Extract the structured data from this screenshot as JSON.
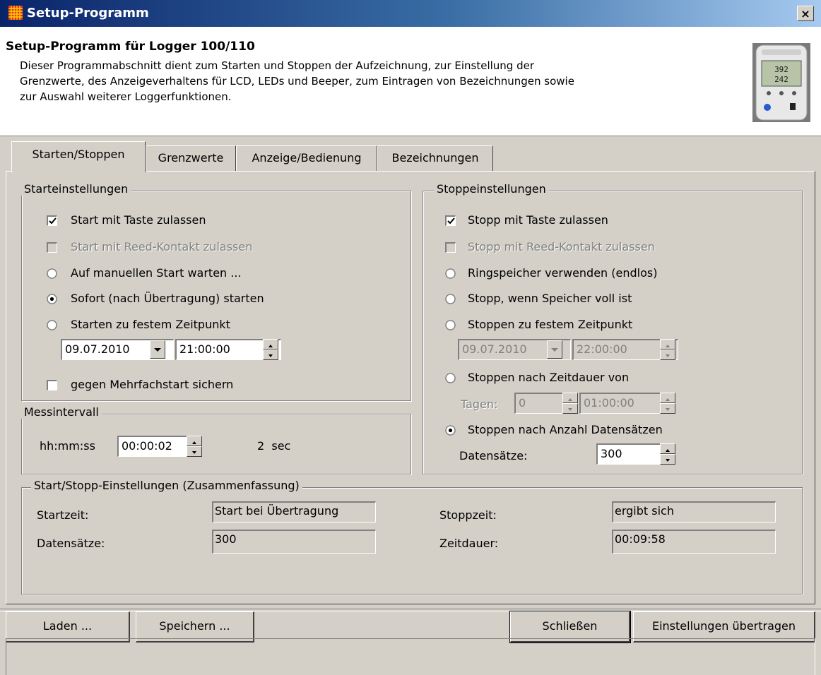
{
  "window": {
    "title": "Setup-Programm",
    "close_label": "×"
  },
  "header": {
    "title": "Setup-Programm für Logger 100/110",
    "desc_line1": "Dieser Programmabschnitt dient zum Starten und Stoppen der Aufzeichnung, zur Einstellung der",
    "desc_line2": "Grenzwerte, des Anzeigeverhaltens für LCD, LEDs und Beeper, zum Eintragen von Bezeichnungen sowie",
    "desc_line3": "zur Auswahl weiterer Loggerfunktionen."
  },
  "tabs": [
    "Starten/Stoppen",
    "Grenzwerte",
    "Anzeige/Bedienung",
    "Bezeichnungen"
  ],
  "start": {
    "legend": "Starteinstellungen",
    "allow_key": {
      "label": "Start mit Taste zulassen",
      "checked": true
    },
    "allow_reed": {
      "label": "Start mit Reed-Kontakt zulassen",
      "checked": false,
      "disabled": true
    },
    "manual": {
      "label": "Auf manuellen Start warten ...",
      "selected": false
    },
    "immediate": {
      "label": "Sofort (nach Übertragung) starten",
      "selected": true
    },
    "fixed": {
      "label": "Starten zu festem Zeitpunkt",
      "selected": false
    },
    "date": "09.07.2010",
    "time": "21:00:00",
    "multi": {
      "label": "gegen Mehrfachstart sichern",
      "checked": false
    }
  },
  "interval": {
    "legend": "Messintervall",
    "unit_label": "hh:mm:ss",
    "value": "00:00:02",
    "readout": "2  sec"
  },
  "stop": {
    "legend": "Stoppeinstellungen",
    "allow_key": {
      "label": "Stopp mit Taste zulassen",
      "checked": true
    },
    "allow_reed": {
      "label": "Stopp mit Reed-Kontakt zulassen",
      "checked": false,
      "disabled": true
    },
    "ring": {
      "label": "Ringspeicher verwenden (endlos)",
      "selected": false
    },
    "full": {
      "label": "Stopp, wenn Speicher voll ist",
      "selected": false
    },
    "fixed": {
      "label": "Stoppen zu festem Zeitpunkt",
      "selected": false
    },
    "date": "09.07.2010",
    "time": "22:00:00",
    "duration": {
      "label": "Stoppen nach Zeitdauer von",
      "selected": false
    },
    "days_label": "Tagen:",
    "days": "0",
    "duration_time": "01:00:00",
    "count": {
      "label": "Stoppen nach Anzahl Datensätzen",
      "selected": true
    },
    "records_label": "Datensätze:",
    "records": "300"
  },
  "summary": {
    "legend": "Start/Stopp-Einstellungen (Zusammenfassung)",
    "start_label": "Startzeit:",
    "start_value": "Start bei Übertragung",
    "records_label": "Datensätze:",
    "records_value": "300",
    "stop_label": "Stoppzeit:",
    "stop_value": "ergibt sich",
    "duration_label": "Zeitdauer:",
    "duration_value": "00:09:58"
  },
  "buttons": {
    "load": "Laden ...",
    "save": "Speichern ...",
    "close": "Schließen",
    "transfer": "Einstellungen übertragen"
  },
  "icons": {
    "app": "grid-app-icon",
    "logger": "logger-device-image",
    "close": "close-icon",
    "spin": "spin-arrows-icon",
    "dropdown": "dropdown-arrow-icon"
  }
}
